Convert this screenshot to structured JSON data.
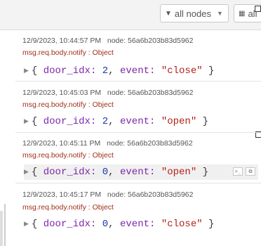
{
  "toolbar": {
    "nodes_filter_label": "all nodes",
    "all_filter_label": "all"
  },
  "messages": [
    {
      "timestamp": "12/9/2023, 10:44:57 PM",
      "node": "node: 56a6b203b83d5962",
      "topic": "msg.req.body.notify : Object",
      "door_idx": "2",
      "event": "\"close\""
    },
    {
      "timestamp": "12/9/2023, 10:45:03 PM",
      "node": "node: 56a6b203b83d5962",
      "topic": "msg.req.body.notify : Object",
      "door_idx": "2",
      "event": "\"open\""
    },
    {
      "timestamp": "12/9/2023, 10:45:11 PM",
      "node": "node: 56a6b203b83d5962",
      "topic": "msg.req.body.notify : Object",
      "door_idx": "0",
      "event": "\"open\""
    },
    {
      "timestamp": "12/9/2023, 10:45:17 PM",
      "node": "node: 56a6b203b83d5962",
      "topic": "msg.req.body.notify : Object",
      "door_idx": "0",
      "event": "\"close\""
    }
  ],
  "syntax": {
    "open": "{",
    "close": "}",
    "door_key": "door_idx:",
    "event_key": "event:",
    "comma": ","
  },
  "colors": {
    "topic": "#a0301b",
    "key": "#7b27a8",
    "number": "#1a3aa8",
    "string": "#b3201a"
  }
}
